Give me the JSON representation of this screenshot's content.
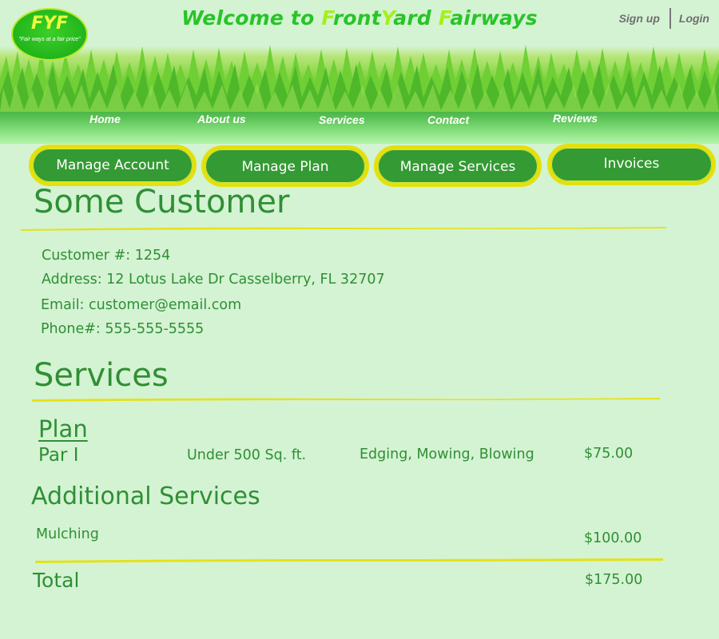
{
  "header": {
    "logo": {
      "title": "FYF",
      "tagline": "\"Fair ways at a fair price\""
    },
    "title_parts": [
      "Welcome to ",
      "F",
      "ront",
      "Y",
      "ard ",
      "F",
      "airways"
    ],
    "auth": {
      "signup": "Sign up",
      "login": "Login"
    },
    "nav": [
      "Home",
      "About us",
      "Services",
      "Contact",
      "Reviews"
    ]
  },
  "account_buttons": [
    "Manage Account",
    "Manage Plan",
    "Manage Services",
    "Invoices"
  ],
  "customer": {
    "name": "Some Customer",
    "number": "Customer #: 1254",
    "address": "Address: 12 Lotus Lake Dr Casselberry, FL 32707",
    "email": "Email: customer@email.com",
    "phone": "Phone#: 555-555-5555"
  },
  "services": {
    "heading": "Services",
    "plan_heading": "Plan",
    "plan": {
      "name": "Par I",
      "size": "Under 500 Sq. ft.",
      "includes": "Edging, Mowing, Blowing",
      "price": "$75.00"
    },
    "additional_heading": "Additional Services",
    "additional": [
      {
        "name": "Mulching",
        "price": "$100.00"
      }
    ],
    "total_label": "Total",
    "total": "$175.00"
  },
  "colors": {
    "background": "#d4f3d3",
    "text_green": "#2f8f34",
    "button_green": "#349a33",
    "button_border": "#e3e10d",
    "title_green": "#28c428",
    "title_highlight": "#a6ef1c",
    "underline_yellow": "#e4e21a"
  }
}
